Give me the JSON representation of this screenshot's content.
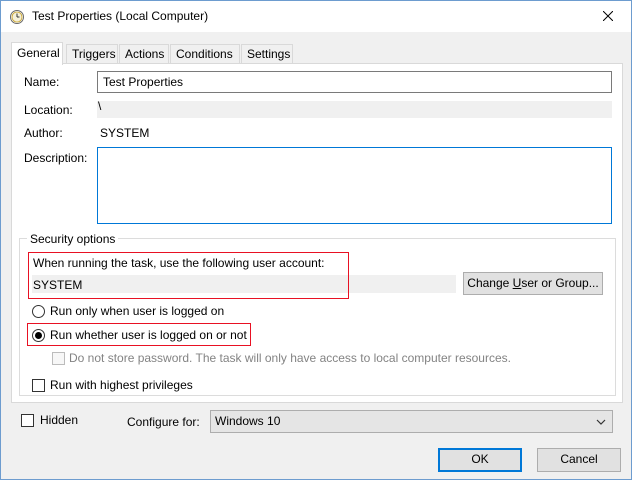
{
  "window": {
    "title": "Test Properties (Local Computer)",
    "icon": "task-scheduler-clock-icon",
    "close_icon": "close-icon"
  },
  "tabs": [
    {
      "label": "General",
      "active": true
    },
    {
      "label": "Triggers",
      "active": false
    },
    {
      "label": "Actions",
      "active": false
    },
    {
      "label": "Conditions",
      "active": false
    },
    {
      "label": "Settings",
      "active": false
    }
  ],
  "general": {
    "name_label": "Name:",
    "name_value": "Test Properties",
    "location_label": "Location:",
    "location_value": "\\",
    "author_label": "Author:",
    "author_value": "SYSTEM",
    "description_label": "Description:",
    "description_value": ""
  },
  "security": {
    "legend": "Security options",
    "account_prompt": "When running the task, use the following user account:",
    "account_value": "SYSTEM",
    "change_button_prefix": "Change ",
    "change_button_underlined": "U",
    "change_button_suffix": "ser or Group...",
    "radio_logged_on": "Run only when user is logged on",
    "radio_whether": "Run whether user is logged on or not",
    "selected_radio": "radio_whether",
    "no_store_password": "Do not store password.  The task will only have access to local computer resources.",
    "no_store_password_checked": false,
    "highest_privileges": "Run with highest privileges",
    "highest_privileges_checked": false
  },
  "footer": {
    "hidden_label": "Hidden",
    "hidden_checked": false,
    "configure_label": "Configure for:",
    "configure_value": "Windows 10",
    "ok_label": "OK",
    "cancel_label": "Cancel"
  },
  "colors": {
    "accent": "#0078d7",
    "highlight_red": "#e81123",
    "window_border": "#6d9ccf"
  }
}
